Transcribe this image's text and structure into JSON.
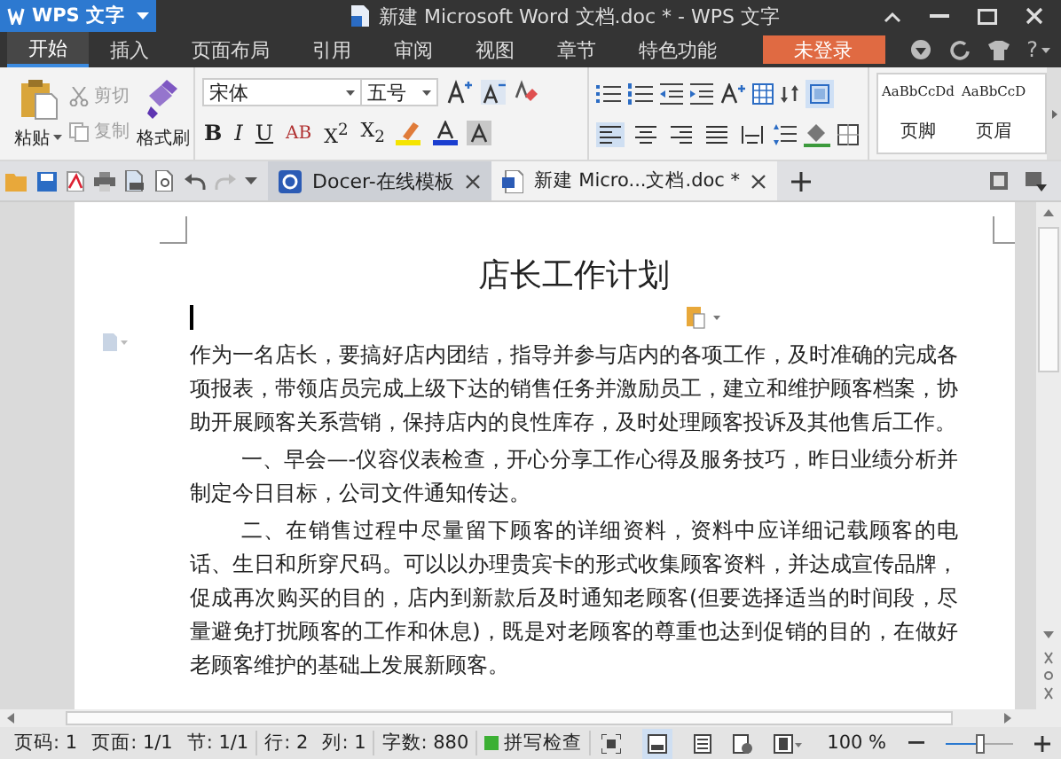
{
  "app_button": {
    "label": "WPS 文字"
  },
  "window": {
    "title": "新建 Microsoft Word 文档.doc * - WPS 文字"
  },
  "menu_tabs": [
    {
      "label": "开始",
      "selected": true
    },
    {
      "label": "插入",
      "selected": false
    },
    {
      "label": "页面布局",
      "selected": false
    },
    {
      "label": "引用",
      "selected": false
    },
    {
      "label": "审阅",
      "selected": false
    },
    {
      "label": "视图",
      "selected": false
    },
    {
      "label": "章节",
      "selected": false
    },
    {
      "label": "特色功能",
      "selected": false
    }
  ],
  "login_button": "未登录",
  "help": "?",
  "clipboard": {
    "paste": "粘贴",
    "cut": {
      "label": "剪切",
      "disabled": true
    },
    "copy": {
      "label": "复制",
      "disabled": true
    },
    "format_painter": "格式刷"
  },
  "font": {
    "name": "宋体",
    "size": "五号"
  },
  "font_buttons": [
    {
      "kind": "bold",
      "label": "B"
    },
    {
      "kind": "italic",
      "label": "I"
    },
    {
      "kind": "underline",
      "label": "U"
    },
    {
      "kind": "strike",
      "label": "AB"
    },
    {
      "kind": "sup",
      "label": "X$^{2}$"
    },
    {
      "kind": "sub",
      "label": "X$_{2}$"
    }
  ],
  "align_buttons": [
    {
      "kind": "left",
      "selected": true
    },
    {
      "kind": "center",
      "selected": false
    },
    {
      "kind": "right",
      "selected": false
    },
    {
      "kind": "justify",
      "selected": false
    },
    {
      "kind": "distribute",
      "selected": false
    }
  ],
  "styles": [
    {
      "sample": "AaBbCcDd",
      "name": "页脚"
    },
    {
      "sample": "AaBbCcD",
      "name": "页眉"
    }
  ],
  "doc_tabs": [
    {
      "label": "Docer-在线模板",
      "selected": false
    },
    {
      "label": "新建 Micro...文档.doc *",
      "selected": true
    }
  ],
  "document": {
    "title": "店长工作计划",
    "paragraphs": [
      {
        "text": "作为一名店长，要搞好店内团结，指导并参与店内的各项工作，及时准确的完成各项报表，带领店员完成上级下达的销售任务并激励员工，建立和维护顾客档案，协助开展顾客关系营销，保持店内的良性库存，及时处理顾客投诉及其他售后工作。",
        "indented": false
      },
      {
        "text": "一、早会—-仪容仪表检查，开心分享工作心得及服务技巧，昨日业绩分析并制定今日目标，公司文件通知传达。",
        "indented": true
      },
      {
        "text": "二、在销售过程中尽量留下顾客的详细资料，资料中应详细记载顾客的电话、生日和所穿尺码。可以以办理贵宾卡的形式收集顾客资料，并达成宣传品牌，促成再次购买的目的，店内到新款后及时通知老顾客(但要选择适当的时间段，尽量避免打扰顾客的工作和休息)，既是对老顾客的尊重也达到促销的目的，在做好老顾客维护的基础上发展新顾客。",
        "indented": true
      }
    ]
  },
  "status_bar": {
    "groups": [
      [
        "页码: 1",
        "页面: 1/1",
        "节: 1/1"
      ],
      [
        "行: 2",
        "列: 1"
      ],
      [
        "字数: 880"
      ]
    ],
    "spell_check": "拼写检查",
    "zoom": "100 %",
    "zoom_slider": {
      "level": 0.5
    }
  }
}
